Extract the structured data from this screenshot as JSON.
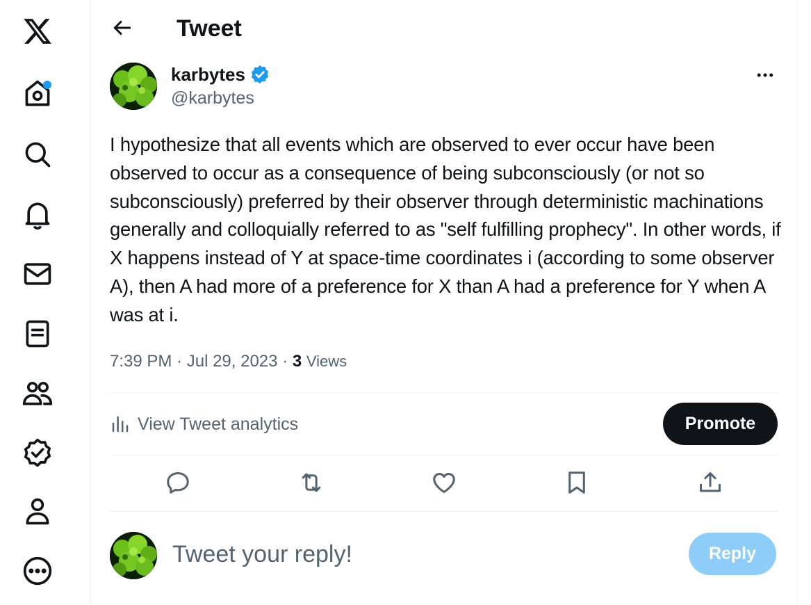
{
  "colors": {
    "accent": "#1d9bf0",
    "text_primary": "#0f1419",
    "text_secondary": "#536471",
    "reply_button_disabled": "#8ecdf8",
    "promote_button": "#0f1419"
  },
  "sidebar": {
    "items": [
      {
        "icon": "x-logo-icon"
      },
      {
        "icon": "home-icon",
        "has_notification_dot": true
      },
      {
        "icon": "search-icon"
      },
      {
        "icon": "bell-icon"
      },
      {
        "icon": "mail-icon"
      },
      {
        "icon": "list-icon"
      },
      {
        "icon": "communities-icon"
      },
      {
        "icon": "verified-badge-icon"
      },
      {
        "icon": "profile-icon"
      },
      {
        "icon": "more-circle-icon"
      }
    ]
  },
  "header": {
    "title": "Tweet"
  },
  "tweet": {
    "author_name": "karbytes",
    "author_handle": "@karbytes",
    "verified": true,
    "text": "I hypothesize that all events which are observed to ever occur have been observed to occur as a consequence of being subconsciously (or not so subconsciously) preferred by their observer through deterministic machinations generally and colloquially referred to as \"self fulfilling prophecy\". In other words, if X happens instead of Y at space-time coordinates i (according to some observer A), then A had more of a preference for X than A had a preference for Y when A was at i.",
    "time": "7:39 PM",
    "separator": "·",
    "date": "Jul 29, 2023",
    "views_count": "3",
    "views_label": "Views"
  },
  "analytics": {
    "label": "View Tweet analytics",
    "promote_label": "Promote"
  },
  "actions": [
    {
      "icon": "reply-icon"
    },
    {
      "icon": "retweet-icon"
    },
    {
      "icon": "like-icon"
    },
    {
      "icon": "bookmark-icon"
    },
    {
      "icon": "share-icon"
    }
  ],
  "reply": {
    "placeholder": "Tweet your reply!",
    "button_label": "Reply"
  }
}
